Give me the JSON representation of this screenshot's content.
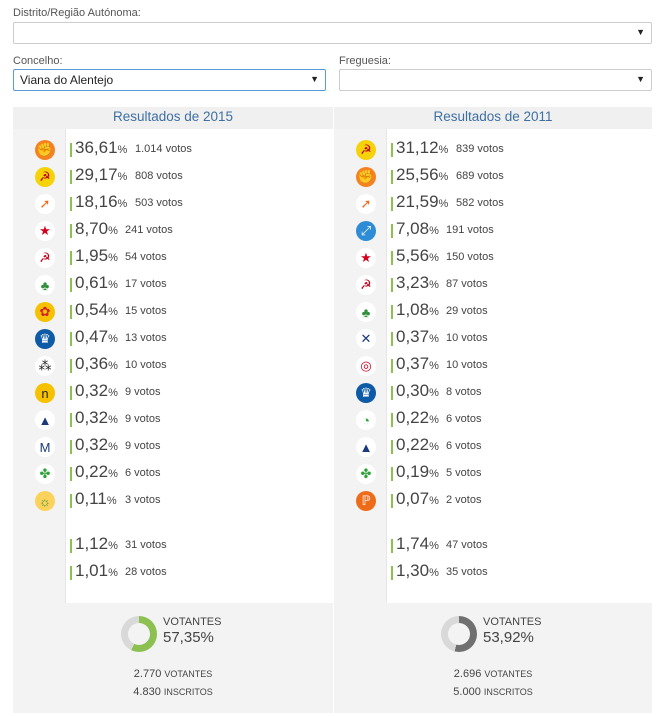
{
  "filters": {
    "district_label": "Distrito/Região Autónoma:",
    "district_value": "",
    "concelho_label": "Concelho:",
    "concelho_value": "Viana do Alentejo",
    "freguesia_label": "Freguesia:",
    "freguesia_value": "",
    "arrow": "▼"
  },
  "results_2015": {
    "title": "Resultados de 2015",
    "rows": [
      {
        "icon": "ps-icon",
        "pct": "36,61",
        "votes": "1.014 votos"
      },
      {
        "icon": "cdu-icon",
        "pct": "29,17",
        "votes": "808 votos"
      },
      {
        "icon": "paf-icon",
        "pct": "18,16",
        "votes": "503 votos"
      },
      {
        "icon": "be-icon",
        "pct": "8,70",
        "votes": "241 votos"
      },
      {
        "icon": "pctp-mrpp-icon",
        "pct": "1,95",
        "votes": "54 votos"
      },
      {
        "icon": "pan-icon",
        "pct": "0,61",
        "votes": "17 votos"
      },
      {
        "icon": "livre-icon",
        "pct": "0,54",
        "votes": "15 votos"
      },
      {
        "icon": "ppm-icon",
        "pct": "0,47",
        "votes": "13 votos"
      },
      {
        "icon": "jpp-icon",
        "pct": "0,36",
        "votes": "10 votos"
      },
      {
        "icon": "nos-icon",
        "pct": "0,32",
        "votes": "9 votos"
      },
      {
        "icon": "pnr-icon",
        "pct": "0,32",
        "votes": "9 votos"
      },
      {
        "icon": "mas-icon",
        "pct": "0,32",
        "votes": "9 votos"
      },
      {
        "icon": "mpt-icon",
        "pct": "0,22",
        "votes": "6 votos"
      },
      {
        "icon": "ptp-icon",
        "pct": "0,11",
        "votes": "3 votos"
      }
    ],
    "blank": {
      "pct": "1,12",
      "votes": "31 votos"
    },
    "null": {
      "pct": "1,01",
      "votes": "28 votos"
    },
    "voters_label": "VOTANTES",
    "voters_pct": "57,35",
    "voters_share": 0.5735,
    "voters_count": "2.770",
    "voters_word": "VOTANTES",
    "registered_count": "4.830",
    "registered_word": "INSCRITOS"
  },
  "results_2011": {
    "title": "Resultados de 2011",
    "rows": [
      {
        "icon": "cdu-icon",
        "pct": "31,12",
        "votes": "839 votos"
      },
      {
        "icon": "ps-icon",
        "pct": "25,56",
        "votes": "689 votos"
      },
      {
        "icon": "psd-icon",
        "pct": "21,59",
        "votes": "582 votos"
      },
      {
        "icon": "cds-icon",
        "pct": "7,08",
        "votes": "191 votos"
      },
      {
        "icon": "be-icon",
        "pct": "5,56",
        "votes": "150 votos"
      },
      {
        "icon": "pctp-mrpp-icon",
        "pct": "3,23",
        "votes": "87 votos"
      },
      {
        "icon": "pan-icon",
        "pct": "1,08",
        "votes": "29 votos"
      },
      {
        "icon": "mep-icon",
        "pct": "0,37",
        "votes": "10 votos"
      },
      {
        "icon": "mrpp-icon",
        "pct": "0,37",
        "votes": "10 votos"
      },
      {
        "icon": "ppm-icon",
        "pct": "0,30",
        "votes": "8 votos"
      },
      {
        "icon": "pnd-icon",
        "pct": "0,22",
        "votes": "6 votos"
      },
      {
        "icon": "pnr-icon",
        "pct": "0,22",
        "votes": "6 votos"
      },
      {
        "icon": "mpt-icon",
        "pct": "0,19",
        "votes": "5 votos"
      },
      {
        "icon": "pdh-icon",
        "pct": "0,07",
        "votes": "2 votos"
      }
    ],
    "blank": {
      "pct": "1,74",
      "votes": "47 votos"
    },
    "null": {
      "pct": "1,30",
      "votes": "35 votos"
    },
    "voters_label": "VOTANTES",
    "voters_pct": "53,92",
    "voters_share": 0.5392,
    "voters_count": "2.696",
    "voters_word": "VOTANTES",
    "registered_count": "5.000",
    "registered_word": "INSCRITOS"
  },
  "pct_sign": "%",
  "colors": {
    "accent_blue": "#3e6fa3",
    "bar_green": "#8cc152",
    "donut_2015": "#8cc152",
    "donut_2011": "#707070",
    "donut_track": "#d9d9d9"
  }
}
